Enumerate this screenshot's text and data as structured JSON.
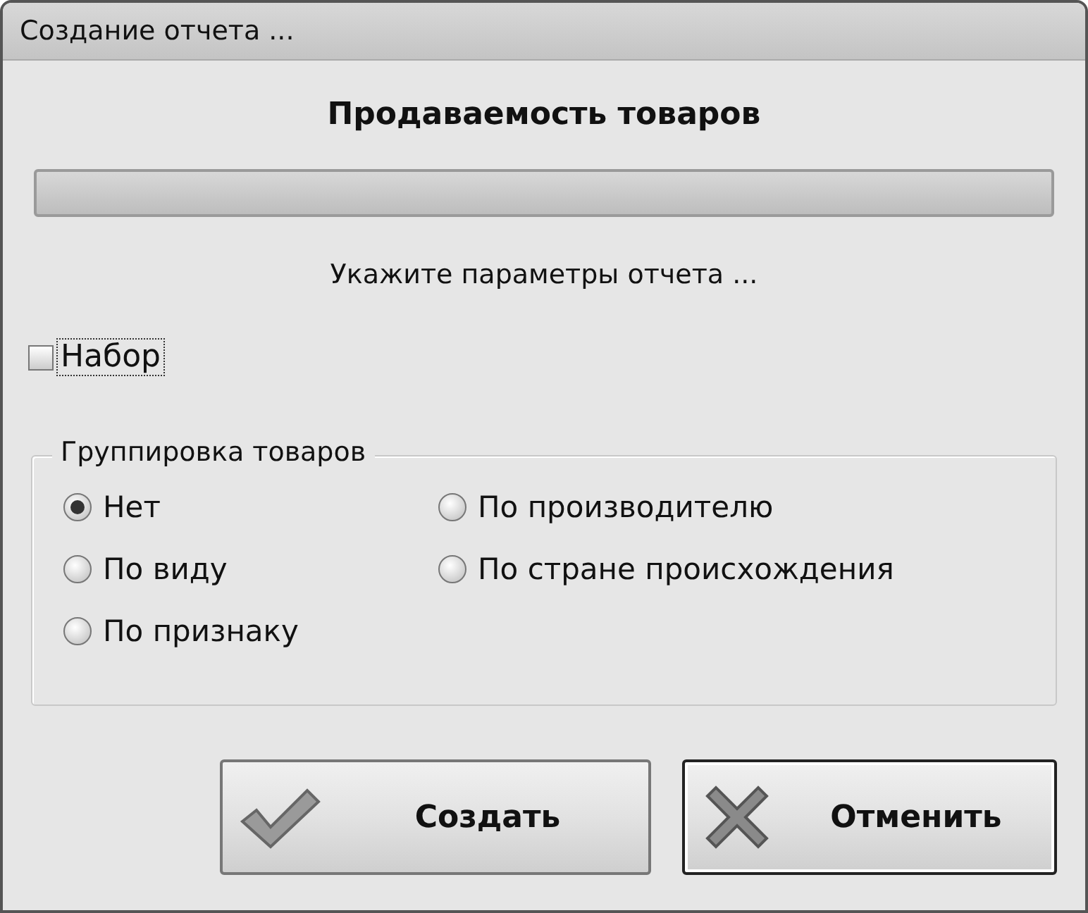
{
  "window": {
    "title": "Создание отчета ..."
  },
  "report_title": "Продаваемость товаров",
  "progress": {
    "level": 0
  },
  "prompt": "Укажите параметры отчета ...",
  "checkbox": {
    "label": "Набор",
    "checked": false,
    "focused": true
  },
  "grouping": {
    "title": "Группировка товаров",
    "options": [
      {
        "label": "Нет",
        "selected": true
      },
      {
        "label": "По производителю",
        "selected": false
      },
      {
        "label": "По виду",
        "selected": false
      },
      {
        "label": "По стране происхождения",
        "selected": false
      },
      {
        "label": "По признаку",
        "selected": false
      }
    ]
  },
  "buttons": [
    {
      "label": "Создать",
      "kind": "ok",
      "focused": false
    },
    {
      "label": "Отменить",
      "kind": "cancel",
      "focused": true
    }
  ]
}
